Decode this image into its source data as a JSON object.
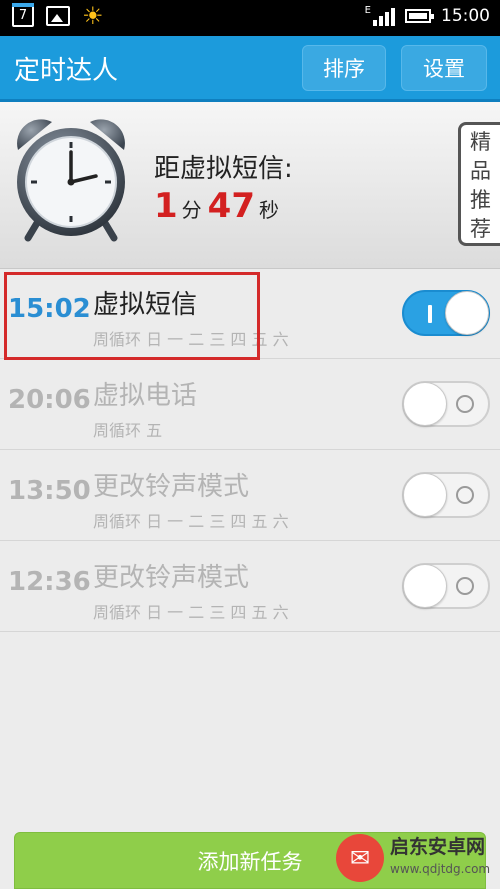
{
  "status_bar": {
    "calendar_day": "7",
    "time": "15:00",
    "icons": [
      "calendar-icon",
      "photo-icon",
      "sun-icon",
      "signal-icon",
      "battery-icon"
    ],
    "signal_label": "E"
  },
  "app_bar": {
    "title": "定时达人",
    "sort_label": "排序",
    "settings_label": "设置",
    "color": "#1c9bdc"
  },
  "countdown": {
    "label": "距虚拟短信:",
    "minutes": "1",
    "minutes_unit": "分",
    "seconds": "47",
    "seconds_unit": "秒",
    "featured_tab": [
      "精",
      "品",
      "推",
      "荐"
    ]
  },
  "tasks": [
    {
      "time": "15:02",
      "title": "虚拟短信",
      "repeat": "周循环 日 一 二 三 四 五 六",
      "enabled": true
    },
    {
      "time": "20:06",
      "title": "虚拟电话",
      "repeat": "周循环 五",
      "enabled": false
    },
    {
      "time": "13:50",
      "title": "更改铃声模式",
      "repeat": "周循环 日 一 二 三 四 五 六",
      "enabled": false
    },
    {
      "time": "12:36",
      "title": "更改铃声模式",
      "repeat": "周循环 日 一 二 三 四 五 六",
      "enabled": false
    }
  ],
  "add_task_label": "添加新任务",
  "watermark": {
    "name": "启东安卓网",
    "url": "www.qdjtdg.com"
  },
  "colors": {
    "active_time": "#2a8ed3",
    "toggle_on": "#2aa1e3",
    "add_button": "#8fce4a",
    "highlight": "#d42a2a",
    "countdown_number": "#d32020"
  }
}
